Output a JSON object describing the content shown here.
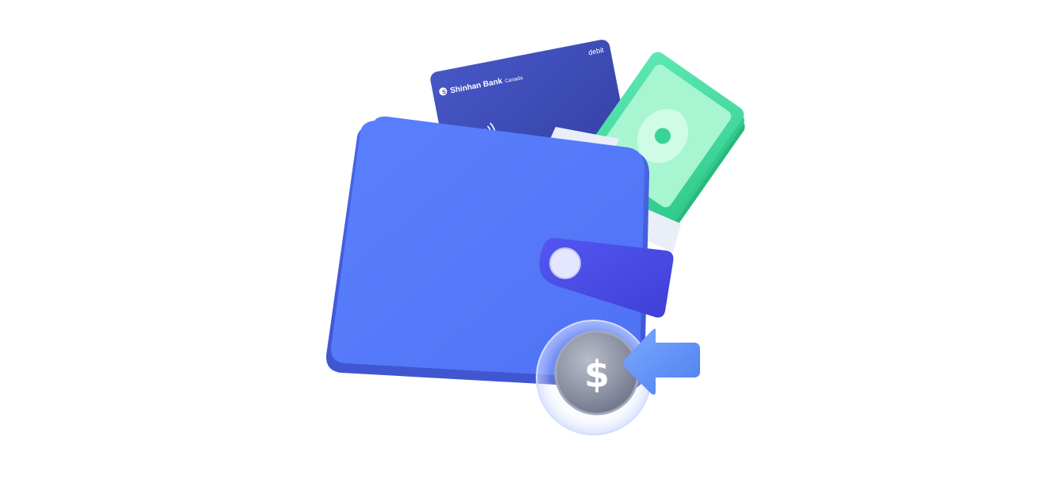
{
  "illustration": {
    "card": {
      "bank_name": "Shinhan Bank",
      "region": "Canada",
      "type": "debit"
    },
    "coin": {
      "symbol": "$"
    },
    "icons": [
      "wallet-icon",
      "debit-card-icon",
      "banknotes-icon",
      "coin-icon",
      "arrow-left-icon"
    ],
    "colors": {
      "wallet": "#5479FB",
      "wallet_strap": "#4B4FEA",
      "card": "#3F4DB9",
      "banknote": "#3DDB9C",
      "coin": "#8F95A6",
      "arrow": "#5B8FF7"
    }
  }
}
